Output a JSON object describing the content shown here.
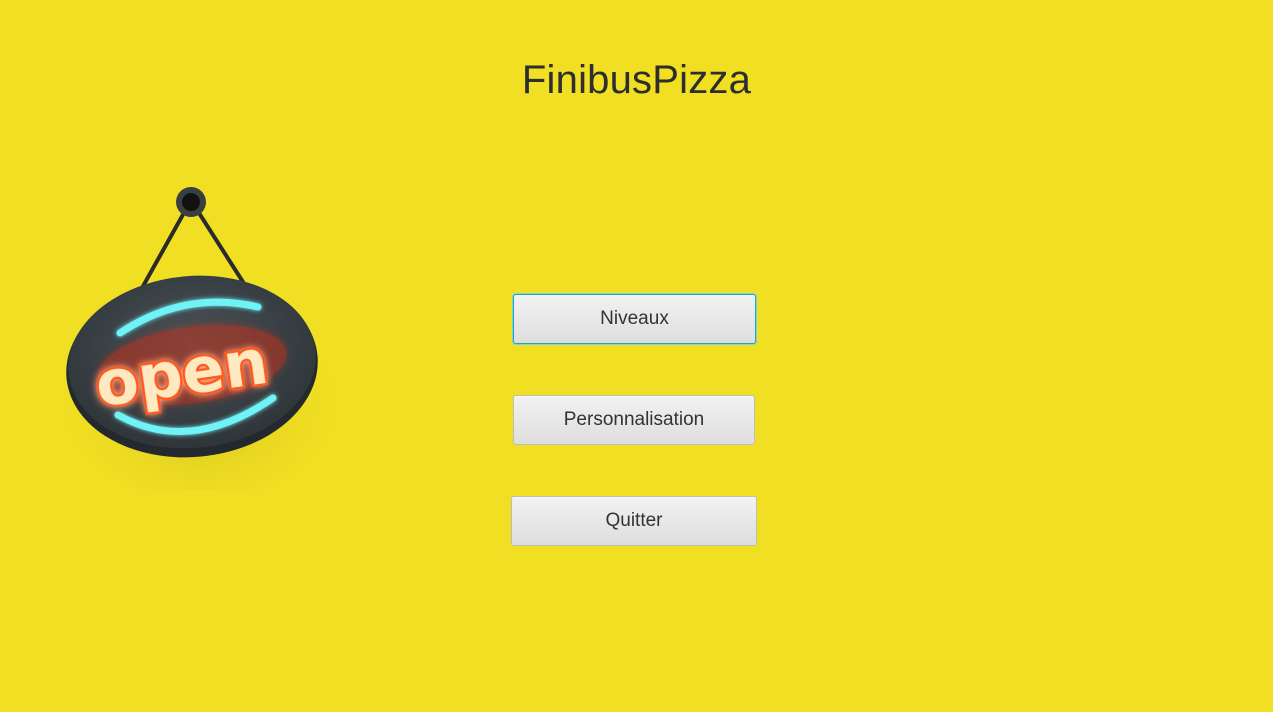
{
  "app": {
    "title": "FinibusPizza",
    "background_color": "#f0df22"
  },
  "sign": {
    "icon": "open-neon-sign",
    "text": "open"
  },
  "menu": {
    "levels_label": "Niveaux",
    "customization_label": "Personnalisation",
    "quit_label": "Quitter",
    "focused_item": "Niveaux"
  }
}
